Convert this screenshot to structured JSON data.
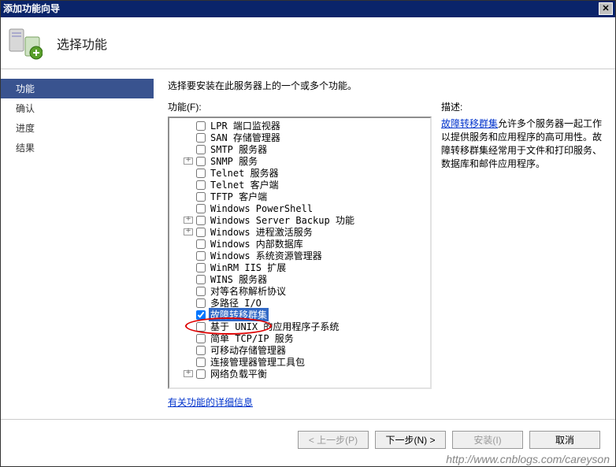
{
  "window": {
    "title": "添加功能向导"
  },
  "header": {
    "heading": "选择功能"
  },
  "sidebar": {
    "items": [
      {
        "label": "功能",
        "active": true
      },
      {
        "label": "确认"
      },
      {
        "label": "进度"
      },
      {
        "label": "结果"
      }
    ]
  },
  "main": {
    "instruction": "选择要安装在此服务器上的一个或多个功能。",
    "features_label": "功能(F):",
    "description_label": "描述:",
    "description_link": "故障转移群集",
    "description_text": "允许多个服务器一起工作以提供服务和应用程序的高可用性。故障转移群集经常用于文件和打印服务、数据库和邮件应用程序。",
    "details_link": "有关功能的详细信息",
    "tree": [
      {
        "indent": 1,
        "exp": "",
        "checked": false,
        "label": "LPR 端口监视器"
      },
      {
        "indent": 1,
        "exp": "",
        "checked": false,
        "label": "SAN 存储管理器"
      },
      {
        "indent": 1,
        "exp": "",
        "checked": false,
        "label": "SMTP 服务器"
      },
      {
        "indent": 1,
        "exp": "+",
        "checked": false,
        "label": "SNMP 服务"
      },
      {
        "indent": 1,
        "exp": "",
        "checked": false,
        "label": "Telnet 服务器"
      },
      {
        "indent": 1,
        "exp": "",
        "checked": false,
        "label": "Telnet 客户端"
      },
      {
        "indent": 1,
        "exp": "",
        "checked": false,
        "label": "TFTP 客户端"
      },
      {
        "indent": 1,
        "exp": "",
        "checked": false,
        "label": "Windows PowerShell"
      },
      {
        "indent": 1,
        "exp": "+",
        "checked": false,
        "label": "Windows Server Backup 功能"
      },
      {
        "indent": 1,
        "exp": "+",
        "checked": false,
        "label": "Windows 进程激活服务"
      },
      {
        "indent": 1,
        "exp": "",
        "checked": false,
        "label": "Windows 内部数据库"
      },
      {
        "indent": 1,
        "exp": "",
        "checked": false,
        "label": "Windows 系统资源管理器"
      },
      {
        "indent": 1,
        "exp": "",
        "checked": false,
        "label": "WinRM IIS 扩展"
      },
      {
        "indent": 1,
        "exp": "",
        "checked": false,
        "label": "WINS 服务器"
      },
      {
        "indent": 1,
        "exp": "",
        "checked": false,
        "label": "对等名称解析协议"
      },
      {
        "indent": 1,
        "exp": "",
        "checked": false,
        "label": "多路径 I/O"
      },
      {
        "indent": 1,
        "exp": "",
        "checked": true,
        "label": "故障转移群集",
        "selected": true
      },
      {
        "indent": 1,
        "exp": "",
        "checked": false,
        "label": "基于 UNIX 的应用程序子系统"
      },
      {
        "indent": 1,
        "exp": "",
        "checked": false,
        "label": "简单 TCP/IP 服务"
      },
      {
        "indent": 1,
        "exp": "",
        "checked": false,
        "label": "可移动存储管理器"
      },
      {
        "indent": 1,
        "exp": "",
        "checked": false,
        "label": "连接管理器管理工具包"
      },
      {
        "indent": 1,
        "exp": "+",
        "checked": false,
        "label": "网络负载平衡"
      }
    ]
  },
  "buttons": {
    "prev": "< 上一步(P)",
    "next": "下一步(N) >",
    "install": "安装(I)",
    "cancel": "取消"
  },
  "watermark": "http://www.cnblogs.com/careyson"
}
